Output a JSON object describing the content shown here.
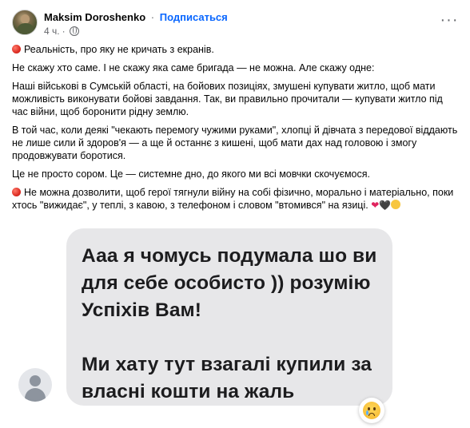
{
  "post": {
    "author": "Maksim Doroshenko",
    "separator": "·",
    "follow_label": "Подписаться",
    "time": "4 ч.",
    "meta_separator": "·",
    "privacy_icon": "globe-icon",
    "more_icon": "more-options-icon",
    "more_label": "···",
    "paragraphs": [
      "Реальність, про яку не кричать з екранів.",
      "Не скажу хто саме. І не скажу яка саме бригада — не можна. Але скажу одне:",
      "Наші військові в Сумській області, на бойових позиціях, змушені купувати житло, щоб мати можливість виконувати бойові завдання. Так, ви правильно прочитали — купувати житло під час війни, щоб боронити рідну землю.",
      "В той час, коли деякі \"чекають перемогу чужими руками\", хлопці й дівчата з передової віддають не лише сили й здоров'я — а ще й останнє з кишені, щоб мати дах над головою і змогу продовжувати боротися.",
      "Це не просто сором. Це — системне дно, до якого ми всі мовчки скочуємося.",
      "Не можна дозволити, щоб герої тягнули війну на собі фізично, морально і матеріально, поки хтось \"вижидає\", у теплі, з кавою, з телефоном і словом \"втомився\" на язиці."
    ],
    "red_circle_icon": "red-circle-icon",
    "end_emojis": {
      "red_heart": "❤",
      "black_heart": "🖤",
      "face_icon": "thinking-face-icon"
    }
  },
  "chat": {
    "avatar_icon": "default-user-avatar-icon",
    "lines": [
      "Ааа я чомусь подумала шо ви",
      "для себе особисто )) розумію",
      "Успіхів Вам!",
      "Ми хату тут взагалі купили за",
      "власні кошти на жаль"
    ],
    "reaction_icon": "crying-face-icon"
  },
  "colors": {
    "link": "#0866ff",
    "muted": "#65676b",
    "bubble": "#e7e7e9"
  }
}
